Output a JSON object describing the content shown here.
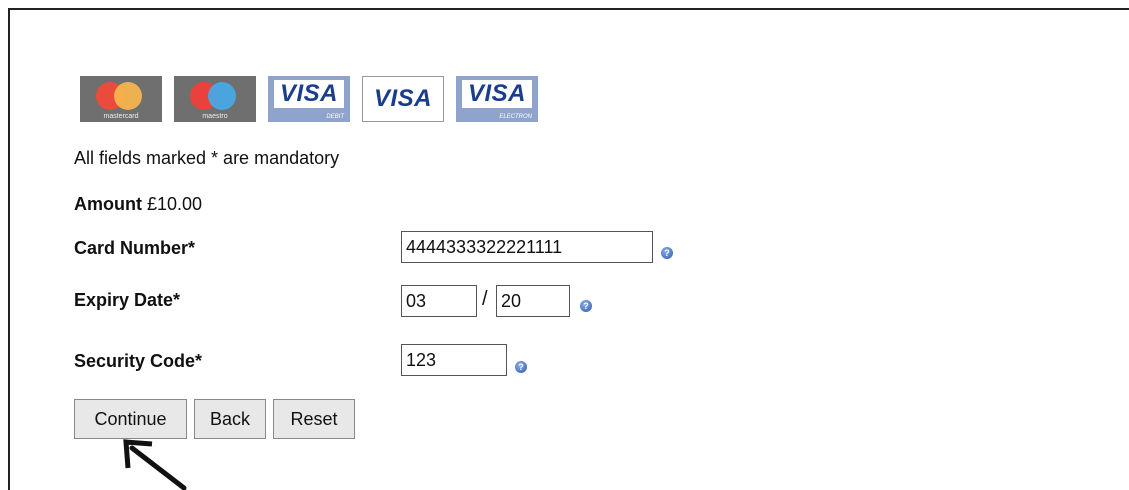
{
  "cards": {
    "mastercard_caption": "mastercard",
    "maestro_caption": "maestro",
    "visa_debit_word": "VISA",
    "visa_debit_sub": "DEBIT",
    "visa_word": "VISA",
    "visa_electron_word": "VISA",
    "visa_electron_sub": "ELECTRON"
  },
  "form": {
    "mandatory_note": "All fields marked * are mandatory",
    "amount_label": "Amount",
    "amount_value": "£10.00",
    "card_number_label": "Card Number*",
    "card_number_value": "4444333322221111",
    "expiry_label": "Expiry Date*",
    "expiry_month": "03",
    "expiry_separator": "/",
    "expiry_year": "20",
    "security_label": "Security Code*",
    "security_value": "123",
    "help_glyph": "?"
  },
  "buttons": {
    "continue": "Continue",
    "back": "Back",
    "reset": "Reset"
  },
  "colors": {
    "mastercard_red": "#eb4b3c",
    "mastercard_orange": "#f8b64c",
    "maestro_red": "#e9413c",
    "maestro_blue": "#47a8e6",
    "visa_blue": "#1a3c8c"
  }
}
